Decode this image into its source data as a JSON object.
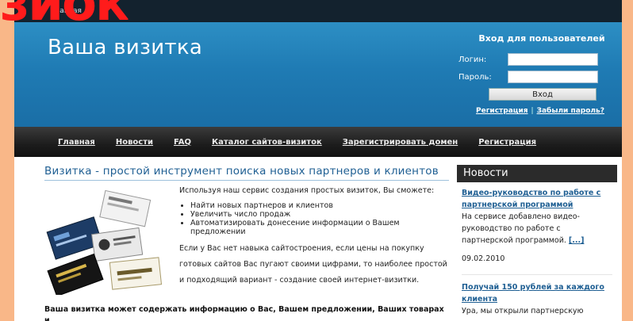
{
  "overlay_text": "зиок",
  "topbar": {
    "home_label": "Главная"
  },
  "header": {
    "site_title": "Ваша визитка"
  },
  "login": {
    "title": "Вход для пользователей",
    "login_label": "Логин:",
    "password_label": "Пароль:",
    "submit_label": "Вход",
    "register_link": "Регистрация",
    "separator": "|",
    "forgot_link": "Забыли пароль?"
  },
  "nav": {
    "items": [
      "Главная",
      "Новости",
      "FAQ",
      "Каталог сайтов-визиток",
      "Зарегистрировать домен",
      "Регистрация"
    ]
  },
  "article": {
    "title": "Визитка - простой инструмент поиска новых партнеров и клиентов",
    "intro": "Используя наш сервис создания простых визиток, Вы сможете:",
    "bullets": [
      "Найти новых партнеров и клиентов",
      "Увеличить число продаж",
      "Автоматизировать донесение информации о Вашем предложении"
    ],
    "para2": "Если у Вас нет навыка сайтостроения, если цены на покупку готовых сайтов Вас пугают своими цифрами, то наиболее простой и подходящий вариант - создание своей интернет-визитки.",
    "bold_line": "Ваша визитка может содержать информацию о Вас, Вашем предложении, Ваших товарах и"
  },
  "sidebar": {
    "title": "Новости",
    "news": [
      {
        "headline": "Видео-руководство по работе с партнерской программой",
        "body": "На сервисе добавлено видео-руководство по работе с партнерской программой.",
        "more": "[...]",
        "date": "09.02.2010"
      },
      {
        "headline": "Получай 150 рублей за каждого клиента",
        "body": "Ура, мы открыли партнерскую"
      }
    ]
  },
  "colors": {
    "page_bg": "#f9b788",
    "header_blue": "#1f7bb4",
    "nav_dark": "#1c1c1c",
    "link_blue": "#1f5f93",
    "overlay_red": "#ff1b1b"
  }
}
